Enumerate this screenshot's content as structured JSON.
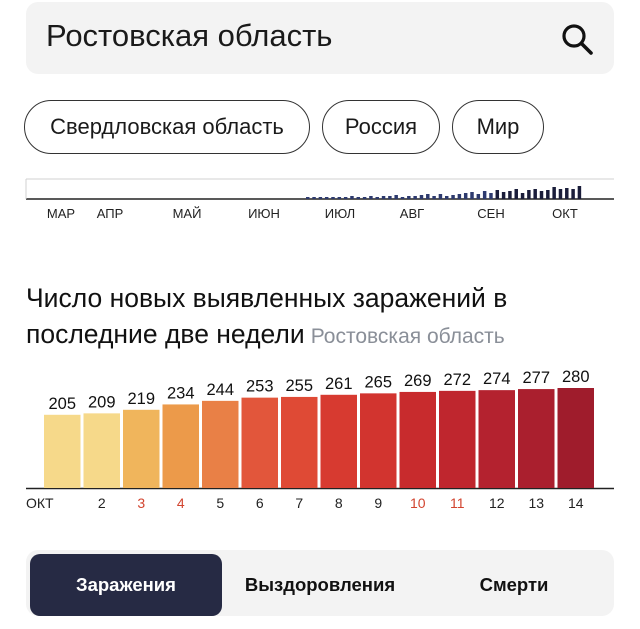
{
  "search": {
    "value": "Ростовская область"
  },
  "chips": [
    {
      "label": "Свердловская область"
    },
    {
      "label": "Россия"
    },
    {
      "label": "Мир"
    }
  ],
  "timeline": {
    "months": [
      "МАР",
      "АПР",
      "МАЙ",
      "ИЮН",
      "ИЮЛ",
      "АВГ",
      "СЕН",
      "ОКТ"
    ],
    "note": "mini overview bars, approximate relative heights",
    "values": [
      0,
      0,
      0,
      0,
      0,
      0,
      0,
      0,
      0,
      0,
      0,
      0,
      0,
      0,
      0,
      0,
      0,
      0,
      0,
      0,
      0,
      0,
      0,
      0,
      0,
      0,
      0,
      0,
      0,
      0,
      0,
      0,
      0,
      0,
      0,
      0,
      0,
      0,
      0,
      0,
      0,
      0,
      0,
      0,
      1,
      1,
      1,
      2,
      1,
      2,
      2,
      3,
      1,
      2,
      3,
      2,
      4,
      3,
      5,
      2,
      4,
      3,
      5,
      6,
      3,
      6,
      4,
      5,
      6,
      7,
      8,
      6,
      9,
      7,
      10,
      8,
      9,
      11,
      7,
      10,
      12,
      9,
      10,
      14,
      11,
      13,
      12,
      15
    ],
    "highlight_count": 14
  },
  "chart_data": {
    "type": "bar",
    "title": "Число новых выявленных заражений в последние две недели",
    "subtitle": "Ростовская область",
    "categories": [
      "ОКТ",
      "2",
      "3",
      "4",
      "5",
      "6",
      "7",
      "8",
      "9",
      "10",
      "11",
      "12",
      "13",
      "14"
    ],
    "values": [
      205,
      209,
      219,
      234,
      244,
      253,
      255,
      261,
      265,
      269,
      272,
      274,
      277,
      280
    ],
    "weekend_categories": [
      "3",
      "4",
      "10",
      "11"
    ],
    "colors": [
      "#f6d98a",
      "#f6d98a",
      "#f0b55c",
      "#ec9a4a",
      "#e98046",
      "#e2563b",
      "#df4a35",
      "#d73a30",
      "#d2342f",
      "#c82b2d",
      "#bf262e",
      "#b4222f",
      "#aa1f2e",
      "#9f1c2c"
    ],
    "weekend_color": "#d2442f",
    "ylim": [
      0,
      280
    ],
    "grid": false,
    "legend": "none"
  },
  "tabs": [
    {
      "label": "Заражения",
      "active": true
    },
    {
      "label": "Выздоровления",
      "active": false
    },
    {
      "label": "Смерти",
      "active": false
    }
  ]
}
